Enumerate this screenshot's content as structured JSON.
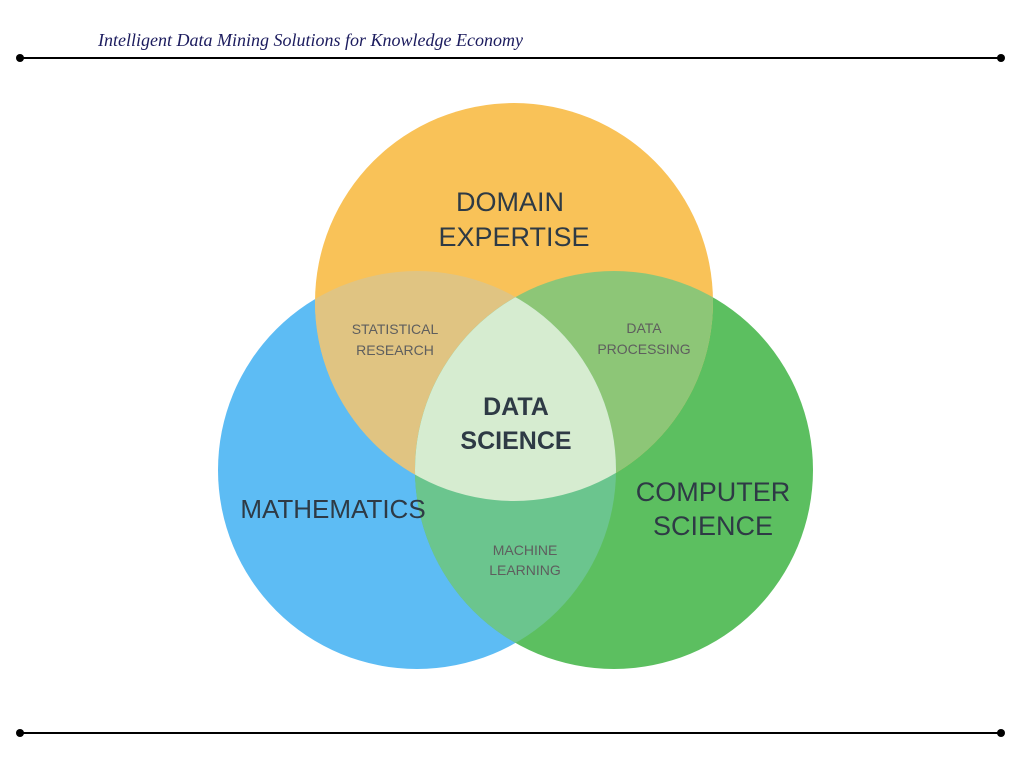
{
  "header": {
    "title": "Intelligent Data Mining Solutions for Knowledge Economy"
  },
  "venn": {
    "sets": {
      "domain": {
        "line1": "DOMAIN",
        "line2": "EXPERTISE",
        "color": "#F9C258"
      },
      "math": {
        "line1": "MATHEMATICS",
        "color": "#5DBCF4"
      },
      "cs": {
        "line1": "COMPUTER",
        "line2": "SCIENCE",
        "color": "#5CBF60"
      }
    },
    "intersections": {
      "statistical_research": {
        "line1": "STATISTICAL",
        "line2": "RESEARCH",
        "color": "#E0C482"
      },
      "data_processing": {
        "line1": "DATA",
        "line2": "PROCESSING",
        "color": "#8DC677"
      },
      "machine_learning": {
        "line1": "MACHINE",
        "line2": "LEARNING",
        "color": "#6BC58E"
      },
      "data_science": {
        "line1": "DATA",
        "line2": "SCIENCE",
        "color": "#D6ECD0"
      }
    }
  }
}
